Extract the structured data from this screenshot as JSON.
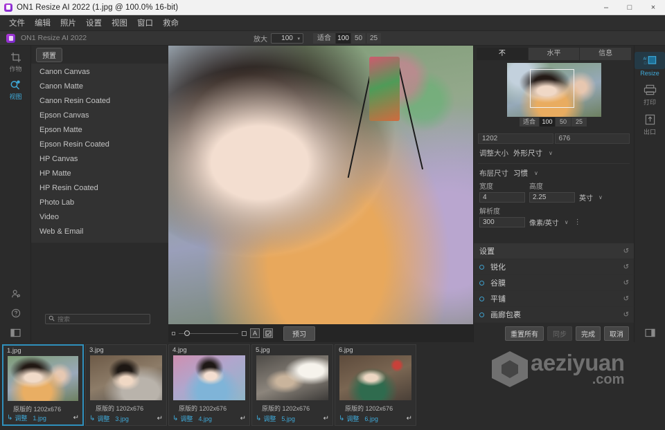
{
  "window": {
    "title": "ON1 Resize AI 2022 (1.jpg @ 100.0% 16-bit)",
    "app_icon": "on1-app-icon",
    "minimize": "–",
    "maximize": "□",
    "close": "×"
  },
  "menubar": {
    "items": [
      {
        "label": "文件"
      },
      {
        "label": "编辑"
      },
      {
        "label": "照片"
      },
      {
        "label": "设置"
      },
      {
        "label": "视图"
      },
      {
        "label": "窗口"
      },
      {
        "label": "救命"
      }
    ]
  },
  "appbar": {
    "title": "ON1 Resize AI 2022",
    "zoom_label": "放大",
    "zoom_value": "100",
    "zoom_caret": "▾",
    "fit_label": "适合",
    "fit_options": [
      "100",
      "50",
      "25"
    ],
    "fit_active": "100"
  },
  "left_rail": {
    "tools": [
      {
        "name": "crop-tool",
        "label": "作物",
        "active": false
      },
      {
        "name": "view-tool",
        "label": "视图",
        "active": true
      }
    ],
    "bottom": [
      {
        "name": "account-icon"
      },
      {
        "name": "help-icon"
      },
      {
        "name": "toggle-left-panel-icon"
      },
      {
        "name": "toggle-filmstrip-icon"
      }
    ]
  },
  "presets": {
    "button_label": "预置",
    "items": [
      "Canon Canvas",
      "Canon Matte",
      "Canon Resin Coated",
      "Epson Canvas",
      "Epson Matte",
      "Epson Resin Coated",
      "HP Canvas",
      "HP Matte",
      "HP Resin Coated",
      "Photo Lab",
      "Video",
      "Web & Email"
    ],
    "search_placeholder": "搜索",
    "search_value": ""
  },
  "viewer": {
    "toolbar": {
      "slider_min_icon": "small-square-icon",
      "slider_max_icon": "large-square-icon",
      "compare_a_label": "A",
      "mask_icon": "mask-view-icon",
      "preview_label": "预习"
    }
  },
  "right_panel": {
    "tabs": [
      {
        "label": "不",
        "active": true
      },
      {
        "label": "水平",
        "active": false
      },
      {
        "label": "信息",
        "active": false
      }
    ],
    "navigator": {
      "fit_label": "适合",
      "options": [
        "100",
        "50",
        "25"
      ],
      "active": "100"
    },
    "dimensions": {
      "width": "1202",
      "height": "676"
    },
    "resize": {
      "label": "调整大小",
      "value": "外形尺寸",
      "caret": "∨"
    },
    "document_size": {
      "label": "布层尺寸",
      "value": "习惯",
      "caret": "∨",
      "width_label": "宽度",
      "height_label": "高度",
      "width_value": "4",
      "height_value": "2.25",
      "unit": "英寸",
      "unit_caret": "∨",
      "resolution_label": "解析度",
      "resolution_value": "300",
      "resolution_unit": "像素/英寸",
      "resolution_caret": "∨",
      "more_icon": "⋮"
    },
    "sections": [
      {
        "name": "设置",
        "header": true,
        "reset_icon": "reset-icon"
      },
      {
        "name": "锐化",
        "header": false,
        "reset_icon": "reset-icon"
      },
      {
        "name": "谷膜",
        "header": false,
        "reset_icon": "reset-icon"
      },
      {
        "name": "平铺",
        "header": false,
        "reset_icon": "reset-icon"
      },
      {
        "name": "画廊包裹",
        "header": false,
        "reset_icon": "reset-icon"
      }
    ],
    "footer": {
      "reset_all": "重置所有",
      "sync": "同步",
      "done": "完成",
      "cancel": "取消",
      "panel_toggle_icon": "toggle-right-panel-icon"
    }
  },
  "right_rail": {
    "items": [
      {
        "name": "resize-module",
        "label": "Resize",
        "active": true
      },
      {
        "name": "print-module",
        "label": "打印",
        "active": false
      },
      {
        "name": "export-module",
        "label": "出口",
        "active": false
      }
    ]
  },
  "filmstrip": {
    "items": [
      {
        "name": "1.jpg",
        "original_label": "原版的",
        "size": "1202x676",
        "adjust_label": "调整",
        "file": "1.jpg",
        "selected": true,
        "thumb_class": "th1"
      },
      {
        "name": "3.jpg",
        "original_label": "原版的",
        "size": "1202x676",
        "adjust_label": "调整",
        "file": "3.jpg",
        "selected": false,
        "thumb_class": "th3"
      },
      {
        "name": "4.jpg",
        "original_label": "原版的",
        "size": "1202x676",
        "adjust_label": "调整",
        "file": "4.jpg",
        "selected": false,
        "thumb_class": "th4"
      },
      {
        "name": "5.jpg",
        "original_label": "原版的",
        "size": "1202x676",
        "adjust_label": "调整",
        "file": "5.jpg",
        "selected": false,
        "thumb_class": "th5"
      },
      {
        "name": "6.jpg",
        "original_label": "原版的",
        "size": "1202x676",
        "adjust_label": "调整",
        "file": "6.jpg",
        "selected": false,
        "thumb_class": "th6"
      }
    ],
    "return_icon": "↵"
  },
  "watermark": {
    "main": "aeziyuan",
    "sub": ".com"
  },
  "colors": {
    "accent": "#3fa9d8",
    "panel_bg": "#2b2b2b",
    "list_bg": "#323232",
    "titlebar_bg": "#f2f2f2"
  }
}
